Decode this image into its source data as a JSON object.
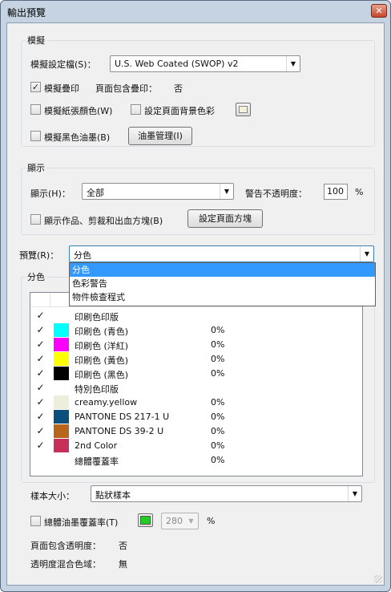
{
  "window": {
    "title": "輸出預覽",
    "close_glyph": "✕"
  },
  "colors": {
    "selection": "#3399ff",
    "window_frame": "#c6d3e3",
    "client_bg": "#f0f0f0"
  },
  "simulation": {
    "group_label": "模擬",
    "profile_label": "模擬設定檔(S)：",
    "profile_value": "U.S. Web Coated (SWOP) v2",
    "overprint": {
      "label": "模擬疊印",
      "checked": true,
      "mark": "✓"
    },
    "page_overprint_label": "頁面包含疊印：",
    "page_overprint_value": "否",
    "paper_color": {
      "label": "模擬紙張顏色(W)",
      "checked": false
    },
    "page_bg": {
      "label": "設定頁面背景色彩",
      "checked": false
    },
    "black_ink": {
      "label": "模擬黑色油墨(B)",
      "checked": false
    },
    "ink_manager_label": "油墨管理(I)"
  },
  "display": {
    "group_label": "顯示",
    "show_label": "顯示(H)：",
    "show_value": "全部",
    "opacity_label": "警告不透明度：",
    "opacity_value": "100",
    "opacity_unit": "%",
    "art_trim_bleed": {
      "label": "顯示作品、剪裁和出血方塊(B)",
      "checked": false
    },
    "page_boxes_label": "設定頁面方塊"
  },
  "preview": {
    "label": "預覽(R)：",
    "value": "分色",
    "options": [
      "分色",
      "色彩警告",
      "物件檢查程式"
    ],
    "selected_index": 0
  },
  "separations": {
    "group_label": "分色",
    "rows": [
      {
        "checked": true,
        "color": "",
        "name": "印刷色印版",
        "percent": ""
      },
      {
        "checked": true,
        "color": "#00ffff",
        "name": "印刷色 (青色)",
        "percent": "0%"
      },
      {
        "checked": true,
        "color": "#ff00ff",
        "name": "印刷色 (洋紅)",
        "percent": "0%"
      },
      {
        "checked": true,
        "color": "#ffff00",
        "name": "印刷色 (黃色)",
        "percent": "0%"
      },
      {
        "checked": true,
        "color": "#000000",
        "name": "印刷色 (黑色)",
        "percent": "0%"
      },
      {
        "checked": true,
        "color": "",
        "name": "特別色印版",
        "percent": ""
      },
      {
        "checked": true,
        "color": "#eeeedd",
        "name": "creamy.yellow",
        "percent": "0%"
      },
      {
        "checked": true,
        "color": "#0b4f7c",
        "name": "PANTONE DS 217-1 U",
        "percent": "0%"
      },
      {
        "checked": true,
        "color": "#b8651d",
        "name": "PANTONE DS 39-2 U",
        "percent": "0%"
      },
      {
        "checked": true,
        "color": "#c8305c",
        "name": "2nd Color",
        "percent": "0%"
      },
      {
        "checked": false,
        "color": "",
        "name": "總體覆蓋率",
        "percent": "0%"
      }
    ],
    "check_mark": "✓"
  },
  "sample_size": {
    "label": "樣本大小：",
    "value": "點狀樣本"
  },
  "total_coverage": {
    "label": "總體油墨覆蓋率(T)",
    "checked": false,
    "color": "#22cc22",
    "value": "280",
    "unit": "%"
  },
  "footer": {
    "page_transparency_label": "頁面包含透明度：",
    "page_transparency_value": "否",
    "blend_space_label": "透明度混合色域：",
    "blend_space_value": "無"
  }
}
